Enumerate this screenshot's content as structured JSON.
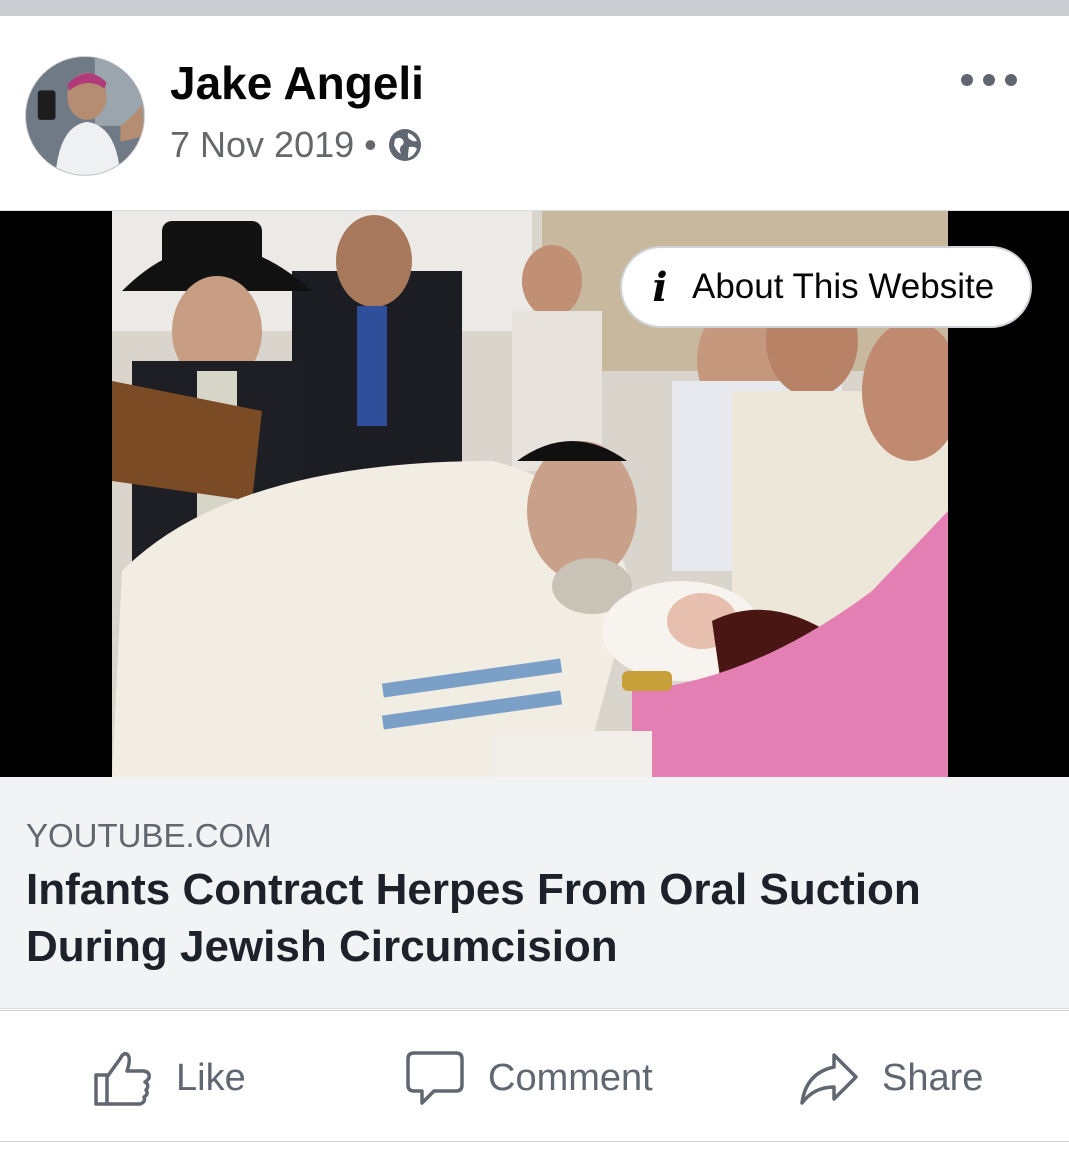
{
  "post": {
    "author": "Jake Angeli",
    "date": "7 Nov 2019",
    "separator": "•",
    "privacy_icon": "globe-icon",
    "more_icon": "more-options-icon"
  },
  "media": {
    "about_label": "About This Website",
    "info_icon": "i"
  },
  "link": {
    "domain": "YOUTUBE.COM",
    "title": "Infants Contract Herpes From Oral Suction During Jewish Circumcision"
  },
  "actions": {
    "like_label": "Like",
    "comment_label": "Comment",
    "share_label": "Share"
  },
  "colors": {
    "secondary_text": "#65676b",
    "card_background": "#f2f3f5",
    "divider": "#ced0d4"
  }
}
